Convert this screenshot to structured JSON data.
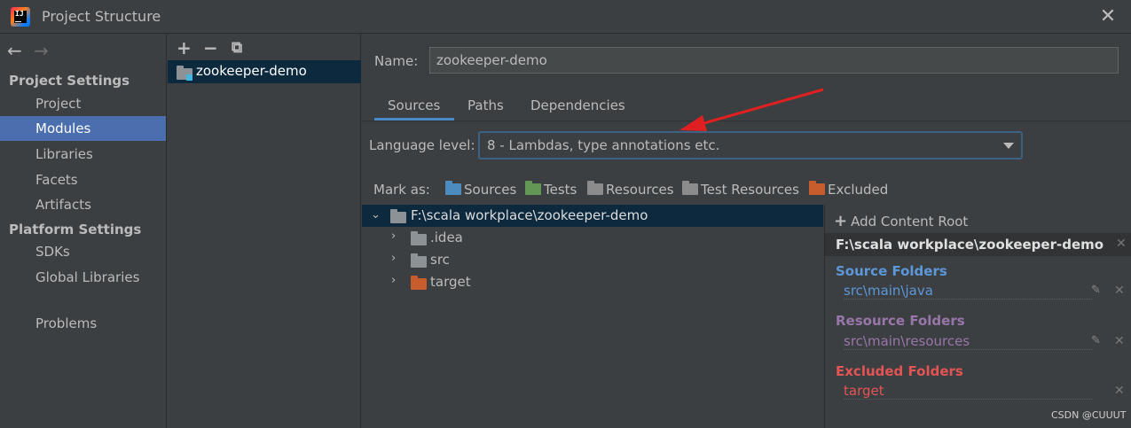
{
  "window": {
    "title": "Project Structure",
    "close": "✕"
  },
  "nav": {
    "back": "←",
    "forward": "→",
    "sections": [
      {
        "label": "Project Settings",
        "items": [
          "Project",
          "Modules",
          "Libraries",
          "Facets",
          "Artifacts"
        ]
      },
      {
        "label": "Platform Settings",
        "items": [
          "SDKs",
          "Global Libraries"
        ]
      }
    ],
    "bottom_item": "Problems",
    "selected": "Modules"
  },
  "modules": {
    "toolbar": {
      "add": "+",
      "remove": "−",
      "copy": "⧉"
    },
    "items": [
      "zookeeper-demo"
    ]
  },
  "module_settings": {
    "name_label": "Name:",
    "name_value": "zookeeper-demo",
    "tabs": [
      "Sources",
      "Paths",
      "Dependencies"
    ],
    "active_tab": "Sources",
    "language_level_label": "Language level:",
    "language_level_value": "8 - Lambdas, type annotations etc.",
    "mark_as_label": "Mark as:",
    "mark_as": [
      {
        "label": "Sources",
        "color": "#4b8bbe"
      },
      {
        "label": "Tests",
        "color": "#629755"
      },
      {
        "label": "Resources",
        "color": "#8c8c8c"
      },
      {
        "label": "Test Resources",
        "color": "#8c8c8c"
      },
      {
        "label": "Excluded",
        "color": "#c75d2c"
      }
    ],
    "tree": {
      "root": "F:\\scala workplace\\zookeeper-demo",
      "children": [
        {
          "label": ".idea",
          "color": "#8c9296"
        },
        {
          "label": "src",
          "color": "#8c9296"
        },
        {
          "label": "target",
          "color": "#c75d2c"
        }
      ]
    },
    "content_root": {
      "add_label": "Add Content Root",
      "path": "F:\\scala workplace\\zookeeper-demo",
      "source_title": "Source Folders",
      "source_path": "src\\main\\java",
      "resource_title": "Resource Folders",
      "resource_path": "src\\main\\resources",
      "excluded_title": "Excluded Folders",
      "excluded_path": "target",
      "colors": {
        "source": "#5c97d9",
        "resource": "#9876aa",
        "excluded": "#e55454"
      }
    }
  },
  "watermark": "CSDN @CUUUT"
}
